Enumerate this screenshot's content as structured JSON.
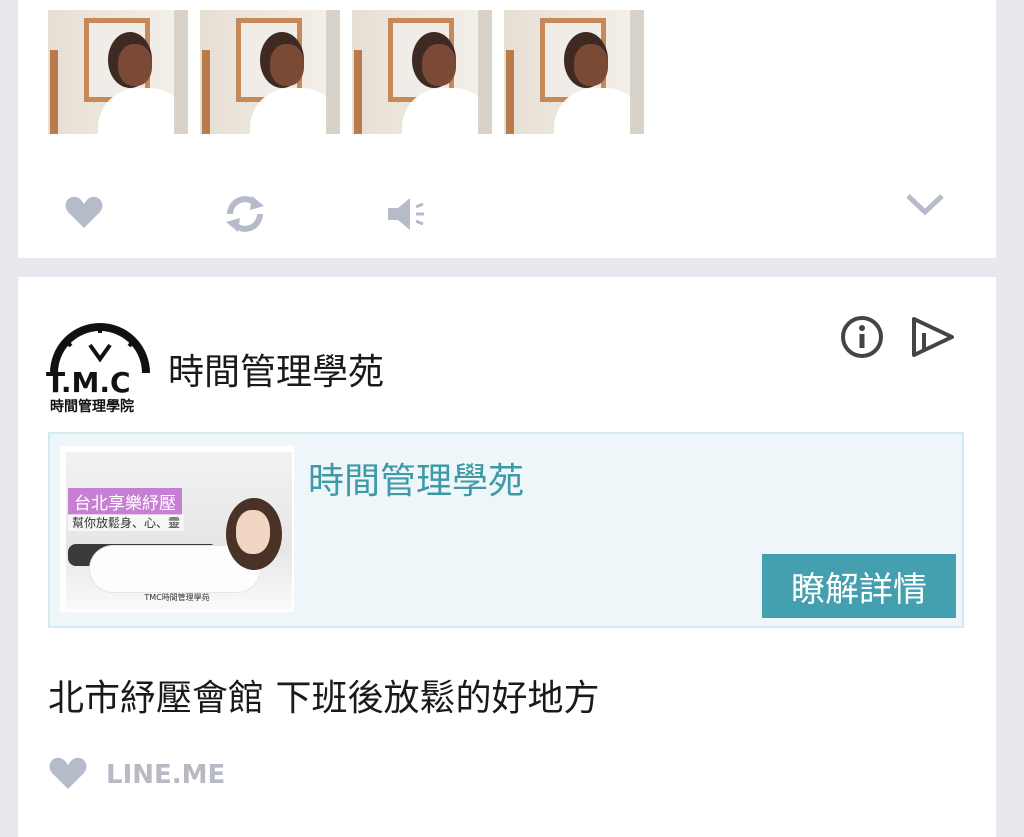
{
  "post_thumbnails": [
    "thumb-1",
    "thumb-2",
    "thumb-3",
    "thumb-4"
  ],
  "action_bar": {
    "icons": [
      "heart-icon",
      "retweet-icon",
      "speaker-icon",
      "chevron-down-icon"
    ],
    "color": "#b6bbc9"
  },
  "ad": {
    "advertiser_name": "時間管理學苑",
    "logo_text": "T.M.C",
    "logo_subtext": "時間管理學院",
    "card": {
      "title": "時間管理學苑",
      "cta_label": "瞭解詳情",
      "image_banner": "台北享樂紓壓",
      "image_subbanner": "幫你放鬆身、心、靈",
      "image_caption": "TMC時間管理學苑"
    },
    "headline": "北市紓壓會館 下班後放鬆的好地方",
    "domain": "LINE.ME",
    "accent_color": "#449faf"
  }
}
